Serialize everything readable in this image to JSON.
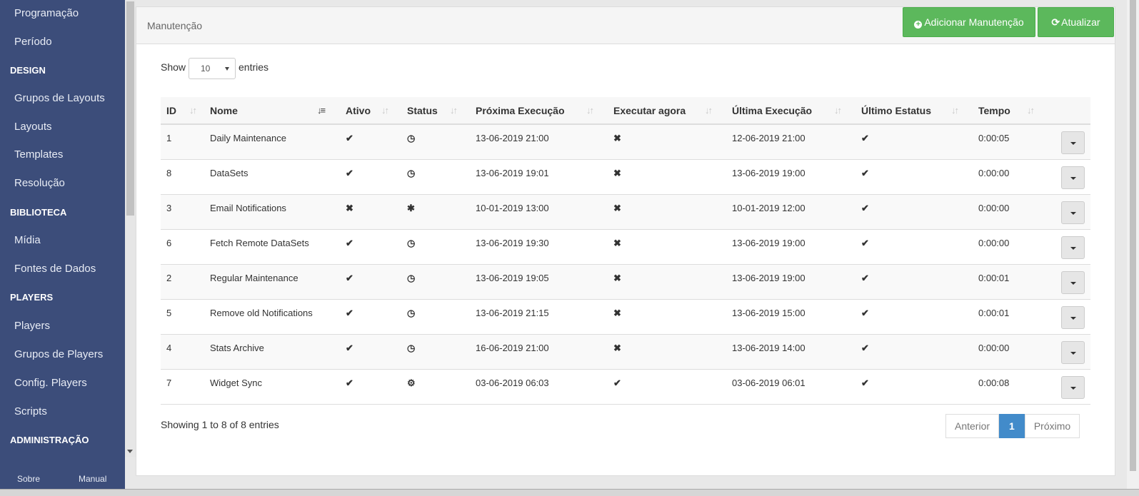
{
  "sidebar": {
    "items": [
      {
        "type": "item",
        "label": "Programação"
      },
      {
        "type": "item",
        "label": "Período"
      },
      {
        "type": "header",
        "label": "DESIGN"
      },
      {
        "type": "item",
        "label": "Grupos de Layouts"
      },
      {
        "type": "item",
        "label": "Layouts"
      },
      {
        "type": "item",
        "label": "Templates"
      },
      {
        "type": "item",
        "label": "Resolução"
      },
      {
        "type": "header",
        "label": "BIBLIOTECA"
      },
      {
        "type": "item",
        "label": "Mídia"
      },
      {
        "type": "item",
        "label": "Fontes de Dados"
      },
      {
        "type": "header",
        "label": "PLAYERS"
      },
      {
        "type": "item",
        "label": "Players"
      },
      {
        "type": "item",
        "label": "Grupos de Players"
      },
      {
        "type": "item",
        "label": "Config. Players"
      },
      {
        "type": "item",
        "label": "Scripts"
      },
      {
        "type": "header",
        "label": "ADMINISTRAÇÃO"
      }
    ],
    "footer": {
      "about": "Sobre",
      "manual": "Manual"
    }
  },
  "panel": {
    "title": "Manutenção",
    "add_button": "Adicionar Manutenção",
    "refresh_button": "Atualizar"
  },
  "length": {
    "show": "Show",
    "value": "10",
    "entries": "entries"
  },
  "table": {
    "columns": [
      "ID",
      "Nome",
      "Ativo",
      "Status",
      "Próxima Execução",
      "Executar agora",
      "Última Execução",
      "Último Estatus",
      "Tempo"
    ],
    "rows": [
      {
        "id": "1",
        "name": "Daily Maintenance",
        "active": "check",
        "status": "clock",
        "next": "13-06-2019 21:00",
        "run_now": "times",
        "last": "12-06-2019 21:00",
        "last_status": "check",
        "time": "0:00:05"
      },
      {
        "id": "8",
        "name": "DataSets",
        "active": "check",
        "status": "clock",
        "next": "13-06-2019 19:01",
        "run_now": "times",
        "last": "13-06-2019 19:00",
        "last_status": "check",
        "time": "0:00:00"
      },
      {
        "id": "3",
        "name": "Email Notifications",
        "active": "times",
        "status": "bug",
        "next": "10-01-2019 13:00",
        "run_now": "times",
        "last": "10-01-2019 12:00",
        "last_status": "check",
        "time": "0:00:00"
      },
      {
        "id": "6",
        "name": "Fetch Remote DataSets",
        "active": "check",
        "status": "clock",
        "next": "13-06-2019 19:30",
        "run_now": "times",
        "last": "13-06-2019 19:00",
        "last_status": "check",
        "time": "0:00:00"
      },
      {
        "id": "2",
        "name": "Regular Maintenance",
        "active": "check",
        "status": "clock",
        "next": "13-06-2019 19:05",
        "run_now": "times",
        "last": "13-06-2019 19:00",
        "last_status": "check",
        "time": "0:00:01"
      },
      {
        "id": "5",
        "name": "Remove old Notifications",
        "active": "check",
        "status": "clock",
        "next": "13-06-2019 21:15",
        "run_now": "times",
        "last": "13-06-2019 15:00",
        "last_status": "check",
        "time": "0:00:01"
      },
      {
        "id": "4",
        "name": "Stats Archive",
        "active": "check",
        "status": "clock",
        "next": "16-06-2019 21:00",
        "run_now": "times",
        "last": "13-06-2019 14:00",
        "last_status": "check",
        "time": "0:00:00"
      },
      {
        "id": "7",
        "name": "Widget Sync",
        "active": "check",
        "status": "cogs",
        "next": "03-06-2019 06:03",
        "run_now": "check",
        "last": "03-06-2019 06:01",
        "last_status": "check",
        "time": "0:00:08"
      }
    ]
  },
  "info": "Showing 1 to 8 of 8 entries",
  "pager": {
    "prev": "Anterior",
    "current": "1",
    "next": "Próximo"
  },
  "colors": {
    "sidebar": "#3c4d7a",
    "button_green": "#5cb85c",
    "pager_active": "#428bca"
  }
}
